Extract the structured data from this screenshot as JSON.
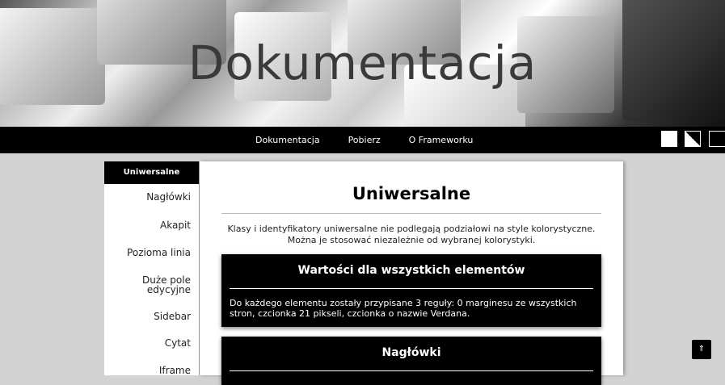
{
  "header": {
    "title": "Dokumentacja"
  },
  "nav": {
    "items": [
      "Dokumentacja",
      "Pobierz",
      "O Frameworku"
    ]
  },
  "theme_switcher": {
    "swatches": [
      "white",
      "black-white",
      "black"
    ]
  },
  "sidebar": {
    "active": "Uniwersalne",
    "items": [
      "Nagłówki",
      "Akapit",
      "Pozioma linia",
      "Duże pole edycyjne",
      "Sidebar",
      "Cytat",
      "Iframe"
    ]
  },
  "main": {
    "title": "Uniwersalne",
    "description": "Klasy i identyfikatory uniwersalne nie podlegają podziałowi na style kolorystyczne. Można je stosować niezależnie od wybranej kolorystyki.",
    "cards": [
      {
        "title": "Wartości dla wszystkich elementów",
        "text": "Do każdego elementu zostały przypisane 3 reguły: 0 marginesu ze wszystkich stron, czcionka 21 pikseli, czcionka o nazwie Verdana."
      },
      {
        "title": "Nagłówki",
        "text": ""
      }
    ]
  },
  "scroll_top": {
    "label": "⇑"
  },
  "colors": {
    "nav_bg": "#000000",
    "page_bg": "#d3d3d3",
    "card_bg": "#000000"
  }
}
